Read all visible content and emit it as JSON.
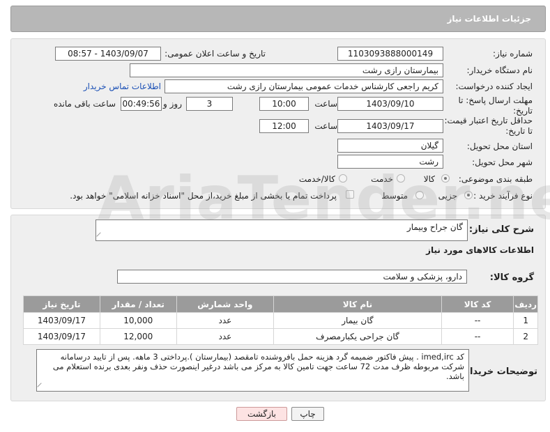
{
  "header": {
    "title": "جزئیات اطلاعات نیاز"
  },
  "form": {
    "need_number_label": "شماره نیاز:",
    "need_number": "1103093888000149",
    "announce_label": "تاریخ و ساعت اعلان عمومی:",
    "announce_value": "1403/09/07 - 08:57",
    "buyer_org_label": "نام دستگاه خریدار:",
    "buyer_org": "بیمارستان رازی رشت",
    "creator_label": "ایجاد کننده درخواست:",
    "creator": "کریم راجعی کارشناس خدمات عمومی بیمارستان رازی رشت",
    "contact_link": "اطلاعات تماس خریدار",
    "deadline_label": "مهلت ارسال پاسخ: تا تاریخ:",
    "deadline_date": "1403/09/10",
    "time_label": "ساعت",
    "deadline_time": "10:00",
    "days": "3",
    "days_label": "روز و",
    "remaining_time": "00:49:56",
    "remaining_label": "ساعت باقی مانده",
    "validity_label": "حداقل تاریخ اعتبار قیمت: تا تاریخ:",
    "validity_date": "1403/09/17",
    "validity_time": "12:00",
    "province_label": "استان محل تحویل:",
    "province": "گیلان",
    "city_label": "شهر محل تحویل:",
    "city": "رشت",
    "category_label": "طبقه بندی موضوعی:",
    "category_options": [
      "کالا",
      "خدمت",
      "کالا/خدمت"
    ],
    "process_label": "نوع فرآیند خرید :",
    "process_options": [
      "جزیی",
      "متوسط"
    ],
    "payment_note": "پرداخت تمام یا بخشی از مبلغ خرید،از محل \"اسناد خزانه اسلامی\" خواهد بود."
  },
  "details": {
    "summary_label": "شرح کلی نیاز:",
    "summary": "گان جراح وبیمار",
    "goods_info_title": "اطلاعات کالاهای مورد نیاز",
    "group_label": "گروه کالا:",
    "group": "دارو، پزشکی و سلامت",
    "table": {
      "headers": [
        "ردیف",
        "کد کالا",
        "نام کالا",
        "واحد شمارش",
        "تعداد / مقدار",
        "تاریخ نیاز"
      ],
      "rows": [
        [
          "1",
          "--",
          "گان بیمار",
          "عدد",
          "10,000",
          "1403/09/17"
        ],
        [
          "2",
          "--",
          "گان جراحی یکبارمصرف",
          "عدد",
          "12,000",
          "1403/09/17"
        ]
      ]
    },
    "buyer_notes_label": "توضیحات خریدار:",
    "buyer_notes": "کد imed,irc . پیش فاکتور ضمیمه گرد هزینه حمل بافروشنده تامقصد (بیمارستان ).پرداختی 3 ماهه. پس از تایید درسامانه شرکت مربوطه ظرف مدت 72 ساعت جهت تامین کالا به مرکز می باشد درغیر اینصورت حذف ونفر بعدی برنده استعلام می باشد."
  },
  "buttons": {
    "print": "چاپ",
    "back": "بازگشت"
  },
  "watermark": "AriaTender.neT"
}
